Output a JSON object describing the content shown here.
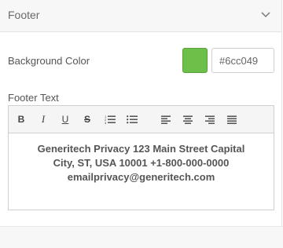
{
  "panel": {
    "title": "Footer",
    "collapse_icon": "chevron-down-icon"
  },
  "background_color": {
    "label": "Background Color",
    "value": "#6cc049",
    "swatch_color": "#6cc049"
  },
  "footer_text": {
    "label": "Footer Text",
    "toolbar": {
      "bold": "B",
      "italic": "I",
      "underline": "U",
      "strikethrough": "S",
      "icons": [
        "ordered-list-icon",
        "unordered-list-icon",
        "align-left-icon",
        "align-center-icon",
        "align-right-icon",
        "align-justify-icon"
      ]
    },
    "lines": [
      "Generitech Privacy 123 Main Street Capital",
      "City, ST, USA 10001 +1-800-000-0000",
      "emailprivacy@generitech.com"
    ]
  }
}
